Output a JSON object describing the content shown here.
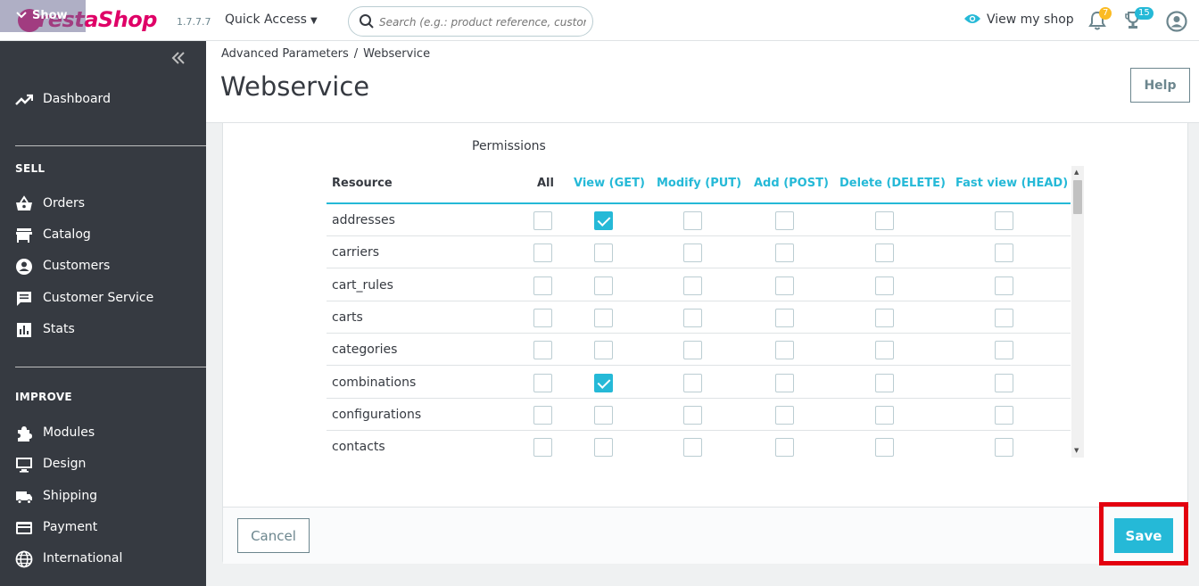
{
  "header": {
    "logo_text": "PrestaShop",
    "show_label": "Show",
    "version": "1.7.7.7",
    "quick_access": "Quick Access",
    "search_placeholder": "Search (e.g.: product reference, custome",
    "view_shop": "View my shop",
    "notifications_count": "7",
    "trophy_count": "15"
  },
  "sidebar": {
    "dashboard": "Dashboard",
    "sell_heading": "SELL",
    "sell_items": [
      "Orders",
      "Catalog",
      "Customers",
      "Customer Service",
      "Stats"
    ],
    "improve_heading": "IMPROVE",
    "improve_items": [
      "Modules",
      "Design",
      "Shipping",
      "Payment",
      "International"
    ]
  },
  "page": {
    "breadcrumb": [
      "Advanced Parameters",
      "Webservice"
    ],
    "title": "Webservice",
    "help": "Help"
  },
  "permissions": {
    "label": "Permissions",
    "columns": [
      "Resource",
      "All",
      "View (GET)",
      "Modify (PUT)",
      "Add (POST)",
      "Delete (DELETE)",
      "Fast view (HEAD)"
    ],
    "rows": [
      {
        "name": "addresses",
        "checked": [
          false,
          true,
          false,
          false,
          false,
          false
        ]
      },
      {
        "name": "carriers",
        "checked": [
          false,
          false,
          false,
          false,
          false,
          false
        ]
      },
      {
        "name": "cart_rules",
        "checked": [
          false,
          false,
          false,
          false,
          false,
          false
        ]
      },
      {
        "name": "carts",
        "checked": [
          false,
          false,
          false,
          false,
          false,
          false
        ]
      },
      {
        "name": "categories",
        "checked": [
          false,
          false,
          false,
          false,
          false,
          false
        ]
      },
      {
        "name": "combinations",
        "checked": [
          false,
          true,
          false,
          false,
          false,
          false
        ]
      },
      {
        "name": "configurations",
        "checked": [
          false,
          false,
          false,
          false,
          false,
          false
        ]
      },
      {
        "name": "contacts",
        "checked": [
          false,
          false,
          false,
          false,
          false,
          false
        ]
      }
    ]
  },
  "footer": {
    "cancel": "Cancel",
    "save": "Save"
  },
  "colors": {
    "accent": "#25b9d7",
    "sidebar_bg": "#363a41",
    "brand_pink": "#df0067",
    "highlight_red": "#e3000f"
  }
}
